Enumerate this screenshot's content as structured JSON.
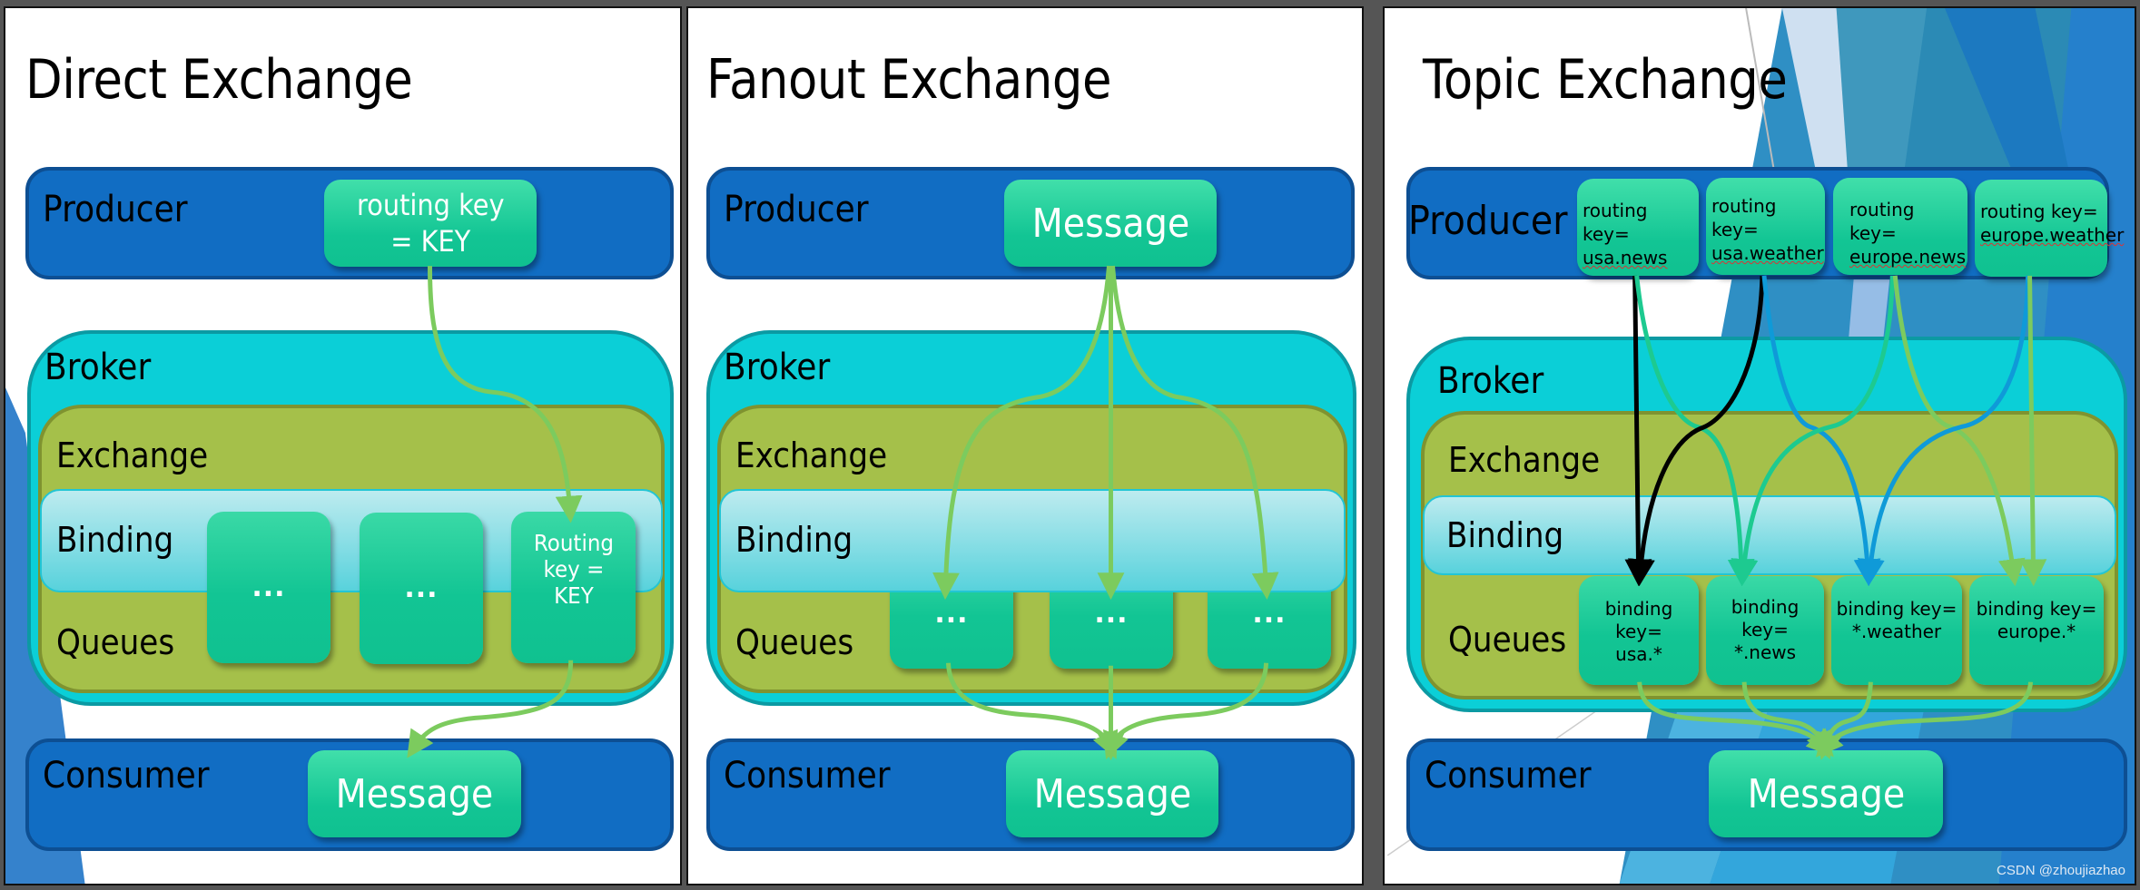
{
  "panels": {
    "direct": {
      "title": "Direct Exchange",
      "producer_label": "Producer",
      "producer_message": "routing key = KEY",
      "producer_message_lines": [
        "routing key",
        "= KEY"
      ],
      "broker_label": "Broker",
      "exchange_label": "Exchange",
      "binding_label": "Binding",
      "queues_label": "Queues",
      "queues": [
        {
          "label": "..."
        },
        {
          "label": "..."
        },
        {
          "label_lines": [
            "Routing",
            "key =",
            "KEY"
          ]
        }
      ],
      "consumer_label": "Consumer",
      "consumer_message": "Message"
    },
    "fanout": {
      "title": "Fanout Exchange",
      "producer_label": "Producer",
      "producer_message": "Message",
      "broker_label": "Broker",
      "exchange_label": "Exchange",
      "binding_label": "Binding",
      "queues_label": "Queues",
      "queues": [
        {
          "label": "..."
        },
        {
          "label": "..."
        },
        {
          "label": "..."
        }
      ],
      "consumer_label": "Consumer",
      "consumer_message": "Message"
    },
    "topic": {
      "title": "Topic Exchange",
      "producer_label": "Producer",
      "routing_keys": [
        {
          "prefix": "routing key=",
          "key": "usa.news"
        },
        {
          "prefix": "routing key=",
          "key": "usa.weather"
        },
        {
          "prefix": "routing key=",
          "key": "europe.news"
        },
        {
          "prefix": "routing key=",
          "key": "europe.weather"
        }
      ],
      "broker_label": "Broker",
      "exchange_label": "Exchange",
      "binding_label": "Binding",
      "queues_label": "Queues",
      "binding_keys": [
        {
          "prefix": "binding key=",
          "key": "usa.*"
        },
        {
          "prefix": "binding key=",
          "key": "*.news"
        },
        {
          "prefix": "binding key=",
          "key": "*.weather"
        },
        {
          "prefix": "binding key=",
          "key": "europe.*"
        }
      ],
      "consumer_label": "Consumer",
      "consumer_message": "Message"
    }
  },
  "routes": {
    "topic": [
      {
        "from": "usa.news",
        "to": [
          "usa.*",
          "*.news"
        ]
      },
      {
        "from": "usa.weather",
        "to": [
          "usa.*",
          "*.weather"
        ]
      },
      {
        "from": "europe.news",
        "to": [
          "*.news",
          "europe.*"
        ]
      },
      {
        "from": "europe.weather",
        "to": [
          "*.weather",
          "europe.*"
        ]
      }
    ]
  },
  "colors": {
    "producer_consumer": "#116dc3",
    "broker": "#0bcfd7",
    "exchange": "#a5c04a",
    "binding": "#8fe0e8",
    "message_box": "#12c594",
    "arrow_green": "#7ccb5e",
    "arrow_teal": "#1dca90",
    "arrow_blue": "#0f9ad8",
    "arrow_black": "#000000"
  },
  "watermark": "CSDN @zhoujiazhao"
}
